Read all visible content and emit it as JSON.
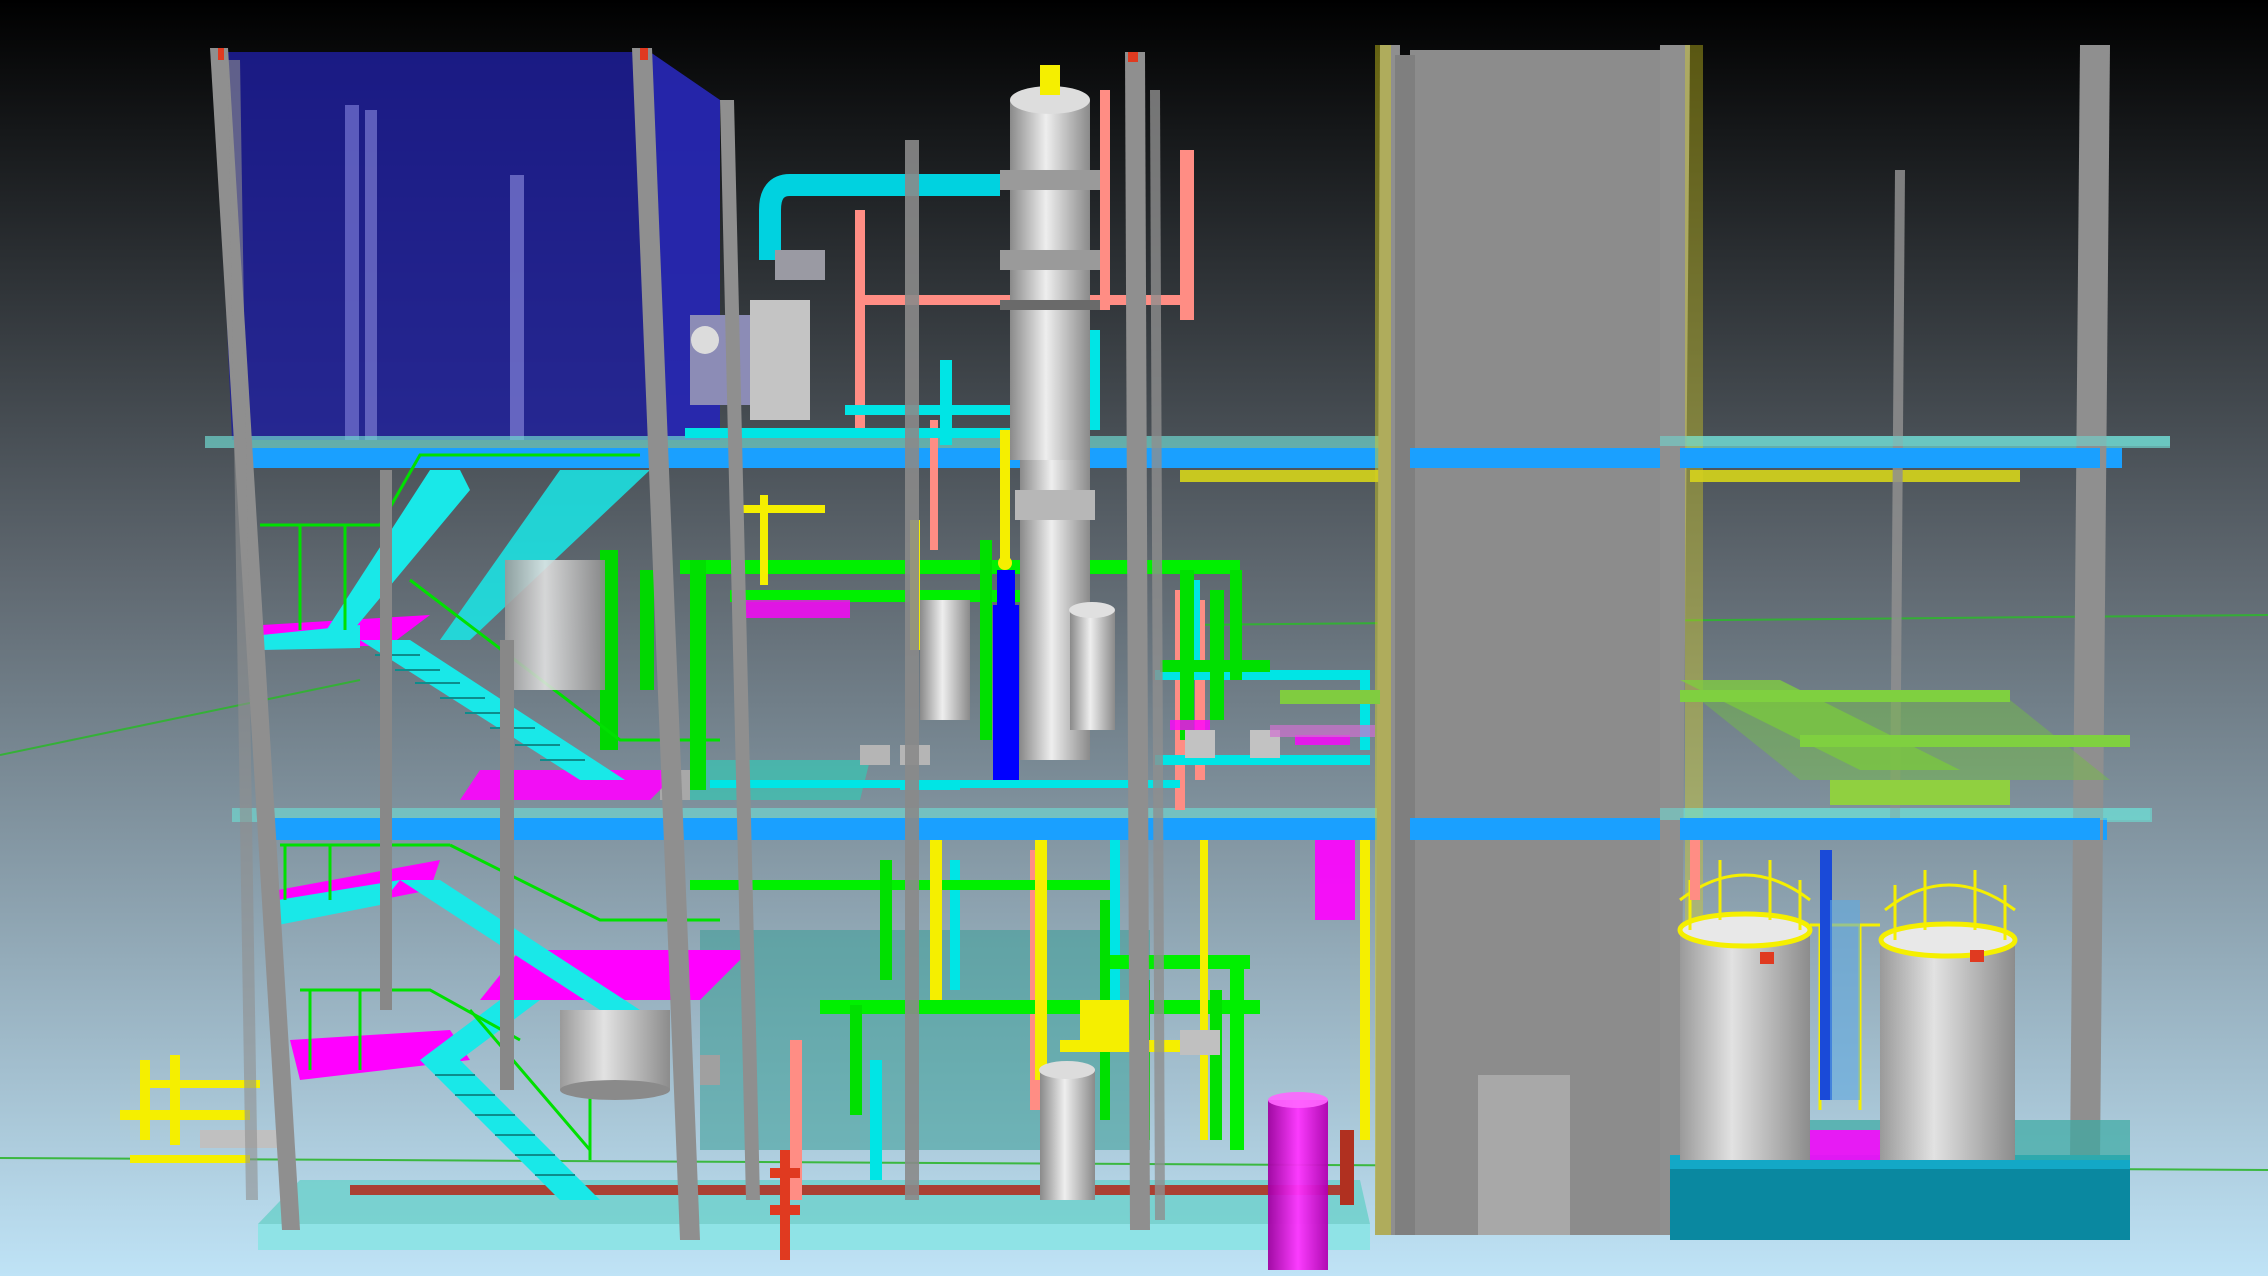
{
  "scene": {
    "kind": "3d-plant-model-viewport",
    "background_gradient": [
      "#000000",
      "#5f6870",
      "#bfe3f6"
    ],
    "colors": {
      "steel_frame": "#8f8f8f",
      "floor_slab": "#8fe3e6",
      "beam_blue": "#1aa0ff",
      "pipe_green": "#00f000",
      "pipe_cyan": "#00e5e5",
      "pipe_yellow": "#f5ef00",
      "pipe_salmon": "#ff8d84",
      "stair_cyan": "#19e8e8",
      "magenta_platform": "#ff00ff",
      "vessel_grey": "#c9c9c9",
      "enclosure_navy": "#1f1f9f",
      "worker_blue": "#0000ff",
      "tank_base_teal": "#0a88a0",
      "guideline_green": "#2fb52f"
    },
    "objects": [
      "steel-structure",
      "glass-enclosure",
      "stairway",
      "distillation-column",
      "pipe-rack",
      "process-pumps",
      "storage-tanks",
      "cladding-block",
      "human-figure"
    ]
  }
}
